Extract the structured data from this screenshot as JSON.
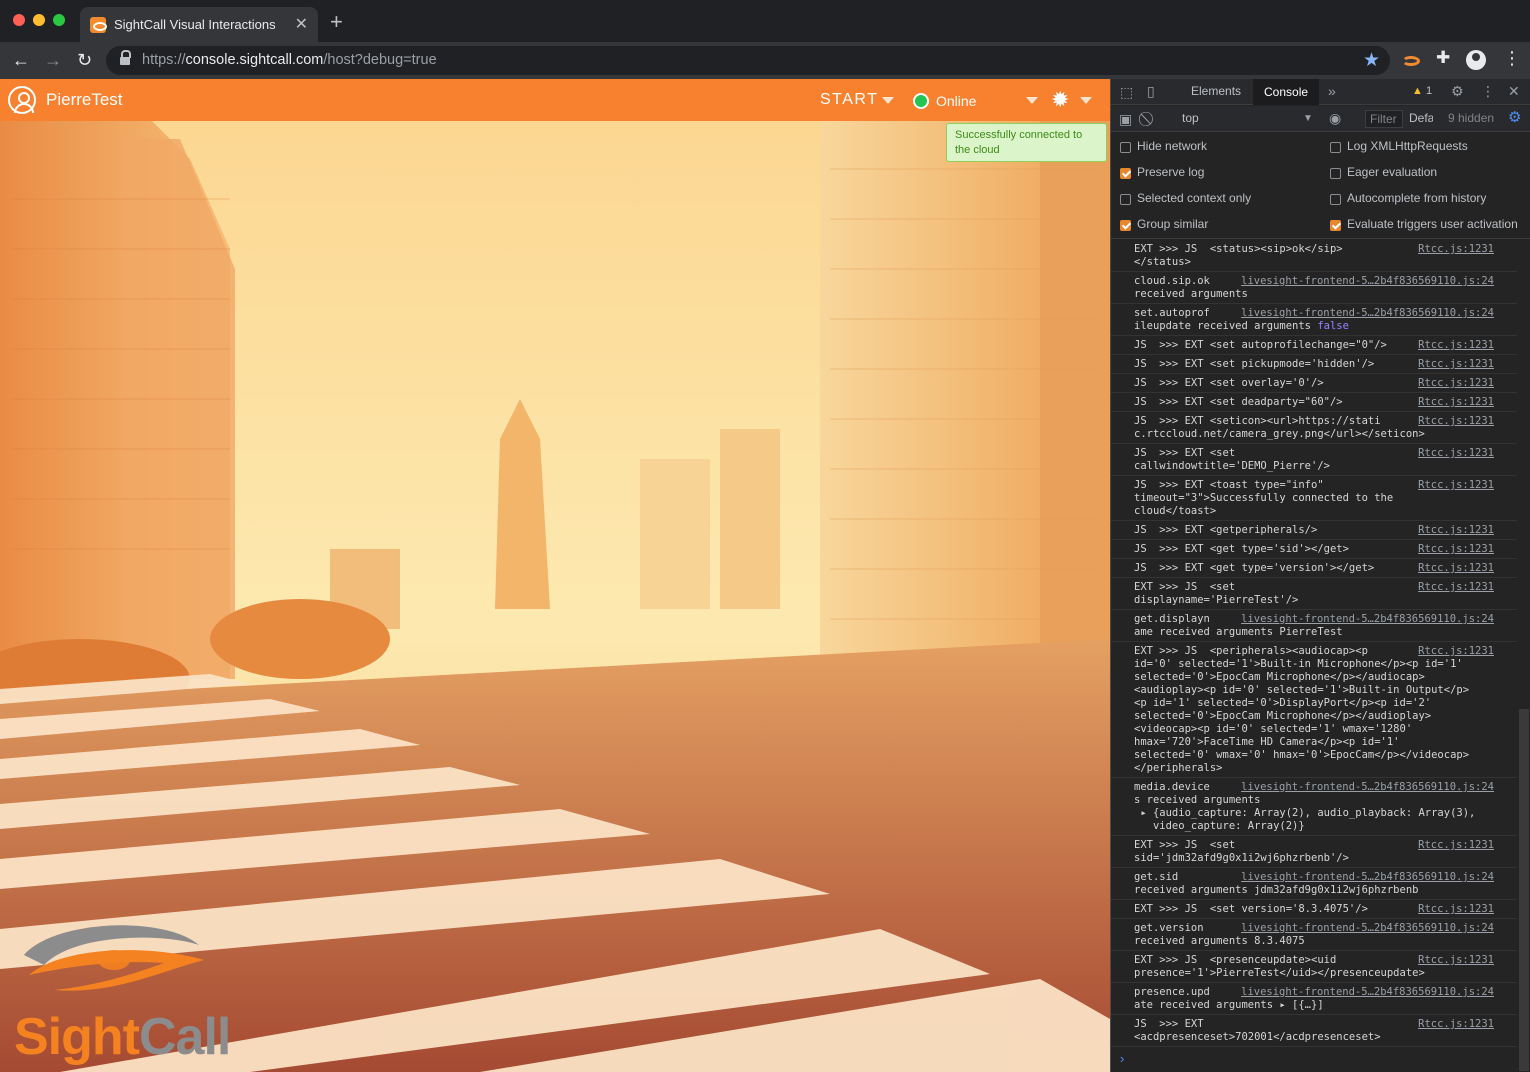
{
  "browser": {
    "tab_title": "SightCall Visual Interactions",
    "close_glyph": "✕",
    "newtab_glyph": "+",
    "url_scheme": "https://",
    "url_host": "console.sightcall.com",
    "url_path": "/host?debug=true",
    "back_glyph": "←",
    "forward_glyph": "→",
    "reload_glyph": "↻",
    "star_glyph": "★",
    "puzzle_glyph": "✚",
    "menu_glyph": "⋮"
  },
  "app": {
    "username": "PierreTest",
    "start_label": "START",
    "status_label": "Online",
    "status_color": "#23c552",
    "brand_color": "#f7812e",
    "gear_glyph": "✹",
    "toast_text": "Successfully connected to the cloud",
    "logo_sight": "Sight",
    "logo_call": "Call"
  },
  "devtools": {
    "tabs": [
      "Elements",
      "Console"
    ],
    "more_glyph": "»",
    "warnings": "1",
    "warn_glyph": "▲",
    "context": "top",
    "filter_placeholder": "Filter",
    "levels": "Default levels",
    "hidden": "9 hidden",
    "settings": [
      {
        "label": "Hide network",
        "checked": false
      },
      {
        "label": "Log XMLHttpRequests",
        "checked": false
      },
      {
        "label": "Preserve log",
        "checked": true
      },
      {
        "label": "Eager evaluation",
        "checked": false
      },
      {
        "label": "Selected context only",
        "checked": false
      },
      {
        "label": "Autocomplete from history",
        "checked": false
      },
      {
        "label": "Group similar",
        "checked": true
      },
      {
        "label": "Evaluate triggers user activation",
        "checked": true
      }
    ],
    "messages": [
      {
        "lines": [
          "EXT >>> JS  <status><sip>ok</sip>",
          "</status>"
        ],
        "src": "Rtcc.js:1231"
      },
      {
        "lines": [
          "cloud.sip.ok",
          "received arguments"
        ],
        "src": "livesight-frontend-5…2b4f836569110.js:24"
      },
      {
        "lines": [
          "set.autoprof",
          "ileupdate received arguments "
        ],
        "src": "livesight-frontend-5…2b4f836569110.js:24",
        "kw": "false"
      },
      {
        "lines": [
          "JS  >>> EXT <set autoprofilechange=\"0\"/>"
        ],
        "src": "Rtcc.js:1231"
      },
      {
        "lines": [
          "JS  >>> EXT <set pickupmode='hidden'/>"
        ],
        "src": "Rtcc.js:1231"
      },
      {
        "lines": [
          "JS  >>> EXT <set overlay='0'/>"
        ],
        "src": "Rtcc.js:1231"
      },
      {
        "lines": [
          "JS  >>> EXT <set deadparty=\"60\"/>"
        ],
        "src": "Rtcc.js:1231"
      },
      {
        "lines": [
          "JS  >>> EXT <seticon><url>https://stati",
          "c.rtccloud.net/camera_grey.png</url></seticon>"
        ],
        "src": "Rtcc.js:1231"
      },
      {
        "lines": [
          "JS  >>> EXT <set",
          "callwindowtitle='DEMO_Pierre'/>"
        ],
        "src": "Rtcc.js:1231"
      },
      {
        "lines": [
          "JS  >>> EXT <toast type=\"info\"",
          "timeout=\"3\">Successfully connected to the",
          "cloud</toast>"
        ],
        "src": "Rtcc.js:1231"
      },
      {
        "lines": [
          "JS  >>> EXT <getperipherals/>"
        ],
        "src": "Rtcc.js:1231"
      },
      {
        "lines": [
          "JS  >>> EXT <get type='sid'></get>"
        ],
        "src": "Rtcc.js:1231"
      },
      {
        "lines": [
          "JS  >>> EXT <get type='version'></get>"
        ],
        "src": "Rtcc.js:1231"
      },
      {
        "lines": [
          "EXT >>> JS  <set",
          "displayname='PierreTest'/>"
        ],
        "src": "Rtcc.js:1231"
      },
      {
        "lines": [
          "get.displayn",
          "ame received arguments PierreTest"
        ],
        "src": "livesight-frontend-5…2b4f836569110.js:24"
      },
      {
        "lines": [
          "EXT >>> JS  <peripherals><audiocap><p",
          "id='0' selected='1'>Built-in Microphone</p><p id='1'",
          "selected='0'>EpocCam Microphone</p></audiocap>",
          "<audioplay><p id='0' selected='1'>Built-in Output</p>",
          "<p id='1' selected='0'>DisplayPort</p><p id='2'",
          "selected='0'>EpocCam Microphone</p></audioplay>",
          "<videocap><p id='0' selected='1' wmax='1280'",
          "hmax='720'>FaceTime HD Camera</p><p id='1'",
          "selected='0' wmax='0' hmax='0'>EpocCam</p></videocap>",
          "</peripherals>"
        ],
        "src": "Rtcc.js:1231"
      },
      {
        "lines": [
          "media.device",
          "s received arguments",
          " ▸ {audio_capture: Array(2), audio_playback: Array(3),",
          "   video_capture: Array(2)}"
        ],
        "src": "livesight-frontend-5…2b4f836569110.js:24"
      },
      {
        "lines": [
          "EXT >>> JS  <set",
          "sid='jdm32afd9g0x1i2wj6phzrbenb'/>"
        ],
        "src": "Rtcc.js:1231"
      },
      {
        "lines": [
          "get.sid",
          "received arguments jdm32afd9g0x1i2wj6phzrbenb"
        ],
        "src": "livesight-frontend-5…2b4f836569110.js:24"
      },
      {
        "lines": [
          "EXT >>> JS  <set version='8.3.4075'/>"
        ],
        "src": "Rtcc.js:1231"
      },
      {
        "lines": [
          "get.version",
          "received arguments 8.3.4075"
        ],
        "src": "livesight-frontend-5…2b4f836569110.js:24"
      },
      {
        "lines": [
          "EXT >>> JS  <presenceupdate><uid",
          "presence='1'>PierreTest</uid></presenceupdate>"
        ],
        "src": "Rtcc.js:1231"
      },
      {
        "lines": [
          "presence.upd",
          "ate received arguments ▸ [{…}]"
        ],
        "src": "livesight-frontend-5…2b4f836569110.js:24"
      },
      {
        "lines": [
          "JS  >>> EXT",
          "<acdpresenceset>702001</acdpresenceset>"
        ],
        "src": "Rtcc.js:1231"
      }
    ],
    "prompt_glyph": "›"
  }
}
